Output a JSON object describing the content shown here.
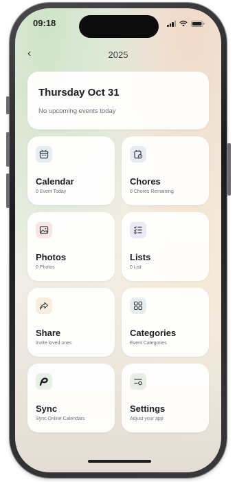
{
  "status": {
    "time": "09:18"
  },
  "header": {
    "back_symbol": "‹",
    "year": "2025"
  },
  "today": {
    "title": "Thursday Oct 31",
    "subtitle": "No upcoming events today"
  },
  "tiles": [
    {
      "title": "Calendar",
      "subtitle": "0 Event Today",
      "icon": "calendar-icon",
      "tint": "#e4edf6"
    },
    {
      "title": "Chores",
      "subtitle": "0 Chores Remaining",
      "icon": "chores-icon",
      "tint": "#e7ecf3"
    },
    {
      "title": "Photos",
      "subtitle": "0 Photos",
      "icon": "photo-icon",
      "tint": "#f6e6e8"
    },
    {
      "title": "Lists",
      "subtitle": "0 List",
      "icon": "checklist-icon",
      "tint": "#ece9f6"
    },
    {
      "title": "Share",
      "subtitle": "Invite loved ones",
      "icon": "share-icon",
      "tint": "#f8eee0"
    },
    {
      "title": "Categories",
      "subtitle": "Event Categories",
      "icon": "categories-icon",
      "tint": "#e6eef2"
    },
    {
      "title": "Sync",
      "subtitle": "Sync Online Calendars",
      "icon": "sync-logo-icon",
      "tint": "#e6f0e6"
    },
    {
      "title": "Settings",
      "subtitle": "Adjust your app",
      "icon": "settings-icon",
      "tint": "#e8ede6"
    }
  ],
  "colors": {
    "text": "#1d1d1f",
    "secondary": "#6e6e73",
    "icon": "#3a3a3c"
  }
}
